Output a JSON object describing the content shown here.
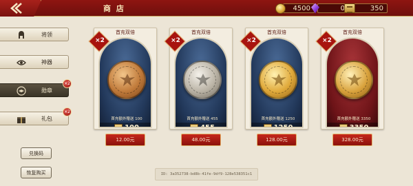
{
  "header": {
    "title": "商 店"
  },
  "currencies": [
    {
      "icon": "gold-coin-icon",
      "value": "4500"
    },
    {
      "icon": "purple-gem-icon",
      "value": "0"
    },
    {
      "icon": "token-icon",
      "value": "350"
    }
  ],
  "sidebar": {
    "items": [
      {
        "label": "将领",
        "icon": "helmet-icon",
        "badge": ""
      },
      {
        "label": "神器",
        "icon": "eye-icon",
        "badge": ""
      },
      {
        "label": "勋章",
        "icon": "medal-icon",
        "badge": "×2"
      },
      {
        "label": "礼包",
        "icon": "gift-box-icon",
        "badge": "×2"
      }
    ],
    "redeem_label": "兑换码",
    "restore_label": "恢复购买"
  },
  "cards": [
    {
      "head": "首充双倍",
      "x2": "×2",
      "bonus": "首充额外赠送",
      "bonus_value": "100",
      "amount": "100",
      "price": "12.00元",
      "theme": "#2e4f7a"
    },
    {
      "head": "首充双倍",
      "x2": "×2",
      "bonus": "首充额外赠送",
      "bonus_value": "455",
      "amount": "455",
      "price": "48.00元",
      "theme": "#2e4f7a"
    },
    {
      "head": "首充双倍",
      "x2": "×2",
      "bonus": "首充额外赠送",
      "bonus_value": "1250",
      "amount": "1250",
      "price": "128.00元",
      "theme": "#2e4f7a"
    },
    {
      "head": "首充双倍",
      "x2": "×2",
      "bonus": "首充额外赠送",
      "bonus_value": "3350",
      "amount": "3350",
      "price": "328.00元",
      "theme": "#7a1a1e"
    }
  ],
  "footer": {
    "id_text": "ID: 3a352738-bd8b-41fe-9df9-128e538351c1"
  },
  "colors": {
    "accent": "#8e1511",
    "gold": "#d8a332",
    "blue_panel": "#2e4f7a",
    "red_panel": "#7a1a1e"
  }
}
